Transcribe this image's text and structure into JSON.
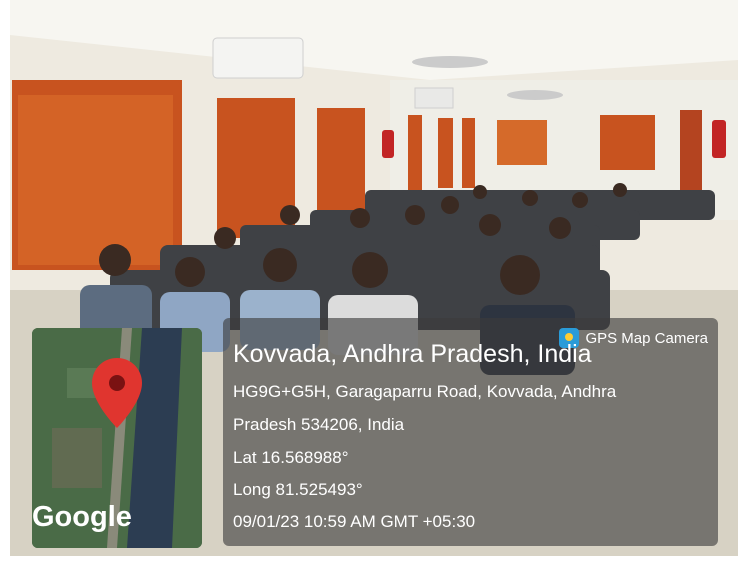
{
  "overlay": {
    "badge": "GPS Map Camera",
    "place": "Kovvada, Andhra Pradesh, India",
    "address_line1": "HG9G+G5H, Garagaparru Road, Kovvada, Andhra",
    "address_line2": "Pradesh 534206, India",
    "lat": "Lat 16.568988°",
    "long": "Long 81.525493°",
    "datetime": "09/01/23 10:59 AM GMT +05:30"
  },
  "map": {
    "logo": "Google"
  },
  "colors": {
    "curtain": "#c8531f",
    "wall": "#f1efe7",
    "chair": "#3f4145",
    "overlay": "#444444",
    "pin": "#e0352f"
  }
}
